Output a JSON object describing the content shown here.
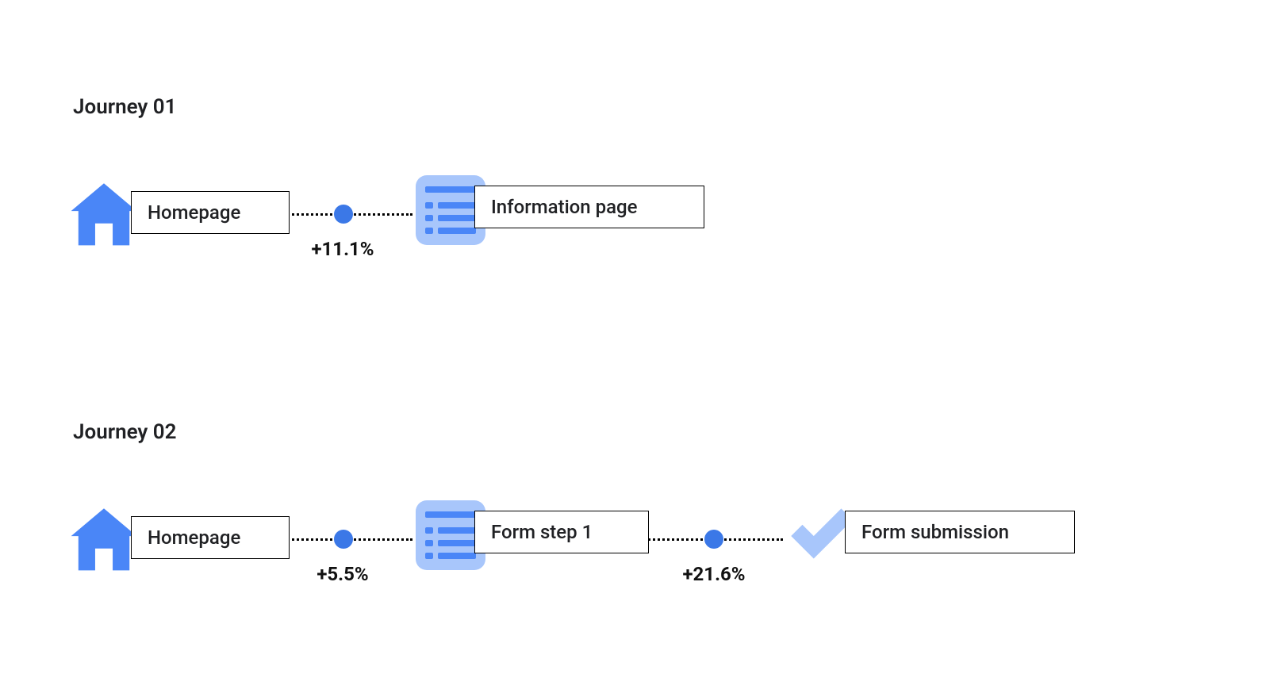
{
  "colors": {
    "accent": "#4a86f7",
    "accent_light": "#a8c6fb",
    "dot": "#3b78e7"
  },
  "journeys": [
    {
      "title": "Journey 01",
      "steps": [
        {
          "icon": "home",
          "label": "Homepage"
        },
        {
          "icon": "page",
          "label": "Information page"
        }
      ],
      "connectors": [
        {
          "delta": "+11.1%"
        }
      ]
    },
    {
      "title": "Journey 02",
      "steps": [
        {
          "icon": "home",
          "label": "Homepage"
        },
        {
          "icon": "page",
          "label": "Form step 1"
        },
        {
          "icon": "check",
          "label": "Form submission"
        }
      ],
      "connectors": [
        {
          "delta": "+5.5%"
        },
        {
          "delta": "+21.6%"
        }
      ]
    }
  ]
}
